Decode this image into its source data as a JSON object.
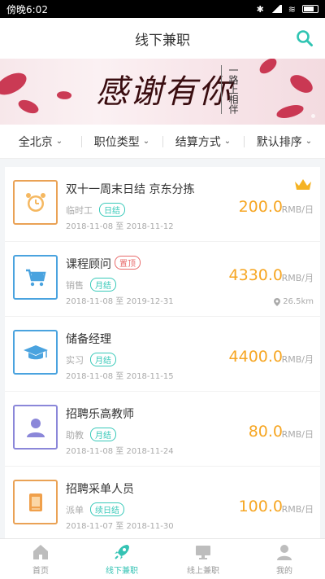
{
  "status": {
    "time": "傍晚6:02"
  },
  "nav": {
    "title": "线下兼职"
  },
  "banner": {
    "title": "感谢有你",
    "subtitle": "一路上相伴"
  },
  "filters": [
    {
      "label": "全北京"
    },
    {
      "label": "职位类型"
    },
    {
      "label": "结算方式"
    },
    {
      "label": "默认排序"
    }
  ],
  "jobs": [
    {
      "title": "双十一周末日结 京东分拣",
      "tag_inline": "",
      "category": "临时工",
      "settle": "日结",
      "dates": "2018-11-08 至 2018-11-12",
      "price": "200.0",
      "unit": "RMB/日",
      "icon": "alarm-clock-icon",
      "color": "#eaa255",
      "distance": ""
    },
    {
      "title": "课程顾问",
      "tag_inline": "置顶",
      "category": "销售",
      "settle": "月结",
      "dates": "2018-11-08 至 2019-12-31",
      "price": "4330.0",
      "unit": "RMB/月",
      "icon": "shopping-cart-icon",
      "color": "#4aa3df",
      "distance": "26.5km"
    },
    {
      "title": "储备经理",
      "tag_inline": "",
      "category": "实习",
      "settle": "月结",
      "dates": "2018-11-08 至 2018-11-15",
      "price": "4400.0",
      "unit": "RMB/月",
      "icon": "graduation-cap-icon",
      "color": "#4aa3df",
      "distance": ""
    },
    {
      "title": "招聘乐高教师",
      "tag_inline": "",
      "category": "助教",
      "settle": "月结",
      "dates": "2018-11-08 至 2018-11-24",
      "price": "80.0",
      "unit": "RMB/日",
      "icon": "person-icon",
      "color": "#8b87d9",
      "distance": ""
    },
    {
      "title": "招聘采单人员",
      "tag_inline": "",
      "category": "派单",
      "settle": "续日结",
      "dates": "2018-11-07 至 2018-11-30",
      "price": "100.0",
      "unit": "RMB/日",
      "icon": "document-icon",
      "color": "#eaa255",
      "distance": ""
    }
  ],
  "tabs": [
    {
      "label": "首页",
      "icon": "home-icon"
    },
    {
      "label": "线下兼职",
      "icon": "rocket-icon",
      "active": true
    },
    {
      "label": "线上兼职",
      "icon": "monitor-icon"
    },
    {
      "label": "我的",
      "icon": "user-icon"
    }
  ]
}
